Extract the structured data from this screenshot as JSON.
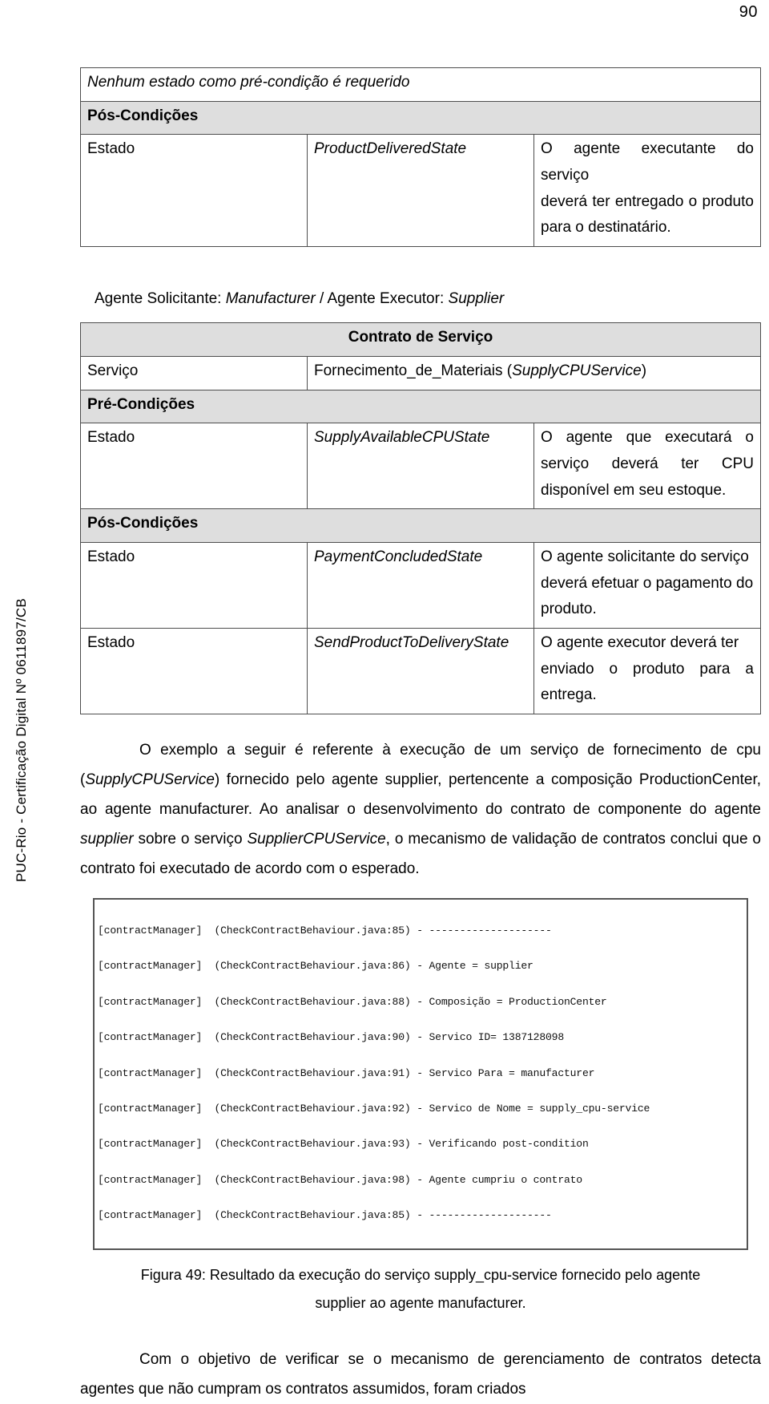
{
  "page": {
    "number": "90",
    "side_watermark": "PUC-Rio - Certificação Digital Nº 0611897/CB"
  },
  "table_top": {
    "note": "Nenhum estado como pré-condição é requerido",
    "postconditions_heading": "Pós-Condições",
    "rows": [
      {
        "label": "Estado",
        "state": "ProductDeliveredState",
        "description_lines": [
          "O agente executante do serviço",
          "deverá ter entregado o produto",
          "para o destinatário."
        ]
      }
    ]
  },
  "agents_line": {
    "prefix": "Agente Solicitante: ",
    "requester": "Manufacturer",
    "separator": " / ",
    "executor_prefix": "Agente Executor: ",
    "executor": "Supplier"
  },
  "table_contract": {
    "title": "Contrato de Serviço",
    "service_label": "Serviço",
    "service_name": "Fornecimento_de_Materiais (",
    "service_code": "SupplyCPUService",
    "service_name_close": ")",
    "preconditions_heading": "Pré-Condições",
    "postconditions_heading": "Pós-Condições",
    "preconditions": [
      {
        "label": "Estado",
        "state": "SupplyAvailableCPUState",
        "description_lines": [
          "O agente que executará o",
          "serviço deverá ter CPU",
          "disponível em seu estoque."
        ]
      }
    ],
    "postconditions": [
      {
        "label": "Estado",
        "state": "PaymentConcludedState",
        "description_lines": [
          "O agente solicitante do serviço",
          "deverá efetuar o pagamento do",
          "produto."
        ]
      },
      {
        "label": "Estado",
        "state": "SendProductToDeliveryState",
        "description_lines": [
          "O agente executor deverá ter",
          "enviado o produto para a",
          "entrega."
        ]
      }
    ]
  },
  "paragraph_example": {
    "part1": "O exemplo a seguir é referente à execução de um serviço de fornecimento de cpu (",
    "italic1": "SupplyCPUService",
    "part2": ") fornecido pelo agente supplier, pertencente a composição ProductionCenter,  ao agente manufacturer. Ao analisar o desenvolvimento do contrato de componente do agente ",
    "italic2": "supplier",
    "part3": " sobre o serviço ",
    "italic3": "SupplierCPUService",
    "part4": ", o mecanismo de validação de contratos conclui que o contrato foi executado de acordo com o esperado."
  },
  "console": {
    "lines": [
      "[contractManager]  (CheckContractBehaviour.java:85) - --------------------",
      "[contractManager]  (CheckContractBehaviour.java:86) - Agente = supplier",
      "[contractManager]  (CheckContractBehaviour.java:88) - Composição = ProductionCenter",
      "[contractManager]  (CheckContractBehaviour.java:90) - Servico ID= 1387128098",
      "[contractManager]  (CheckContractBehaviour.java:91) - Servico Para = manufacturer",
      "[contractManager]  (CheckContractBehaviour.java:92) - Servico de Nome = supply_cpu-service",
      "[contractManager]  (CheckContractBehaviour.java:93) - Verificando post-condition",
      "[contractManager]  (CheckContractBehaviour.java:98) - Agente cumpriu o contrato",
      "[contractManager]  (CheckContractBehaviour.java:85) - --------------------"
    ]
  },
  "figure_caption": "Figura 49: Resultado da execução do serviço supply_cpu-service fornecido pelo agente supplier ao agente manufacturer.",
  "paragraph_final": "Com o objetivo de verificar se o mecanismo de gerenciamento de contratos detecta agentes que não cumpram os contratos assumidos, foram criados"
}
